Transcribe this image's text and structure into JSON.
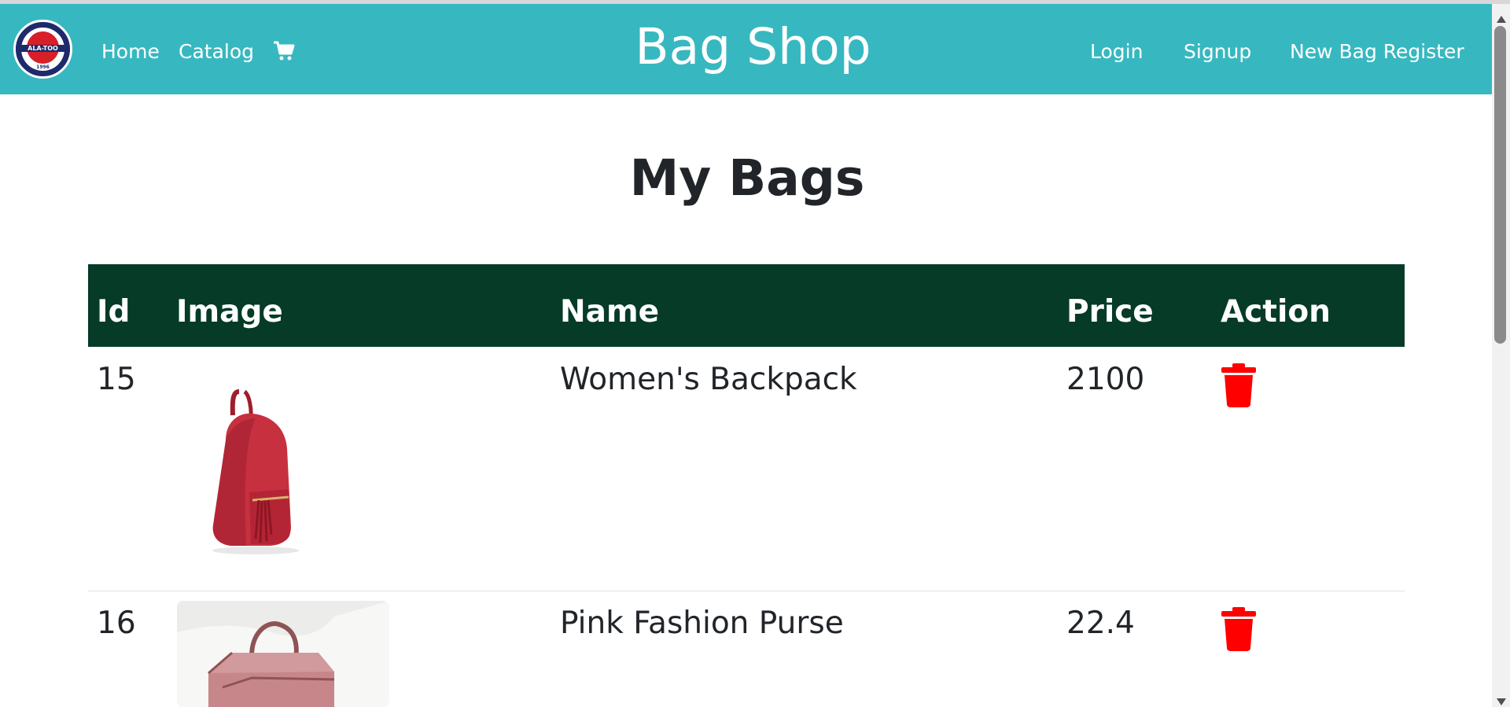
{
  "navbar": {
    "logo_text": "ALA-TOO",
    "logo_year": "1996",
    "home": "Home",
    "catalog": "Catalog",
    "cart_icon": "shopping-cart-icon",
    "brand": "Bag Shop",
    "login": "Login",
    "signup": "Signup",
    "new_bag": "New Bag Register"
  },
  "page": {
    "title": "My Bags"
  },
  "table": {
    "headers": {
      "id": "Id",
      "image": "Image",
      "name": "Name",
      "price": "Price",
      "action": "Action"
    },
    "rows": [
      {
        "id": "15",
        "name": "Women's Backpack",
        "price": "2100",
        "image": "red-backpack-image",
        "action_icon": "trash-icon"
      },
      {
        "id": "16",
        "name": "Pink Fashion Purse",
        "price": "22.4",
        "image": "pink-purse-image",
        "action_icon": "trash-icon"
      }
    ]
  },
  "colors": {
    "navbar": "#37b8c0",
    "table_header": "#053b27",
    "delete": "#ff0000"
  }
}
